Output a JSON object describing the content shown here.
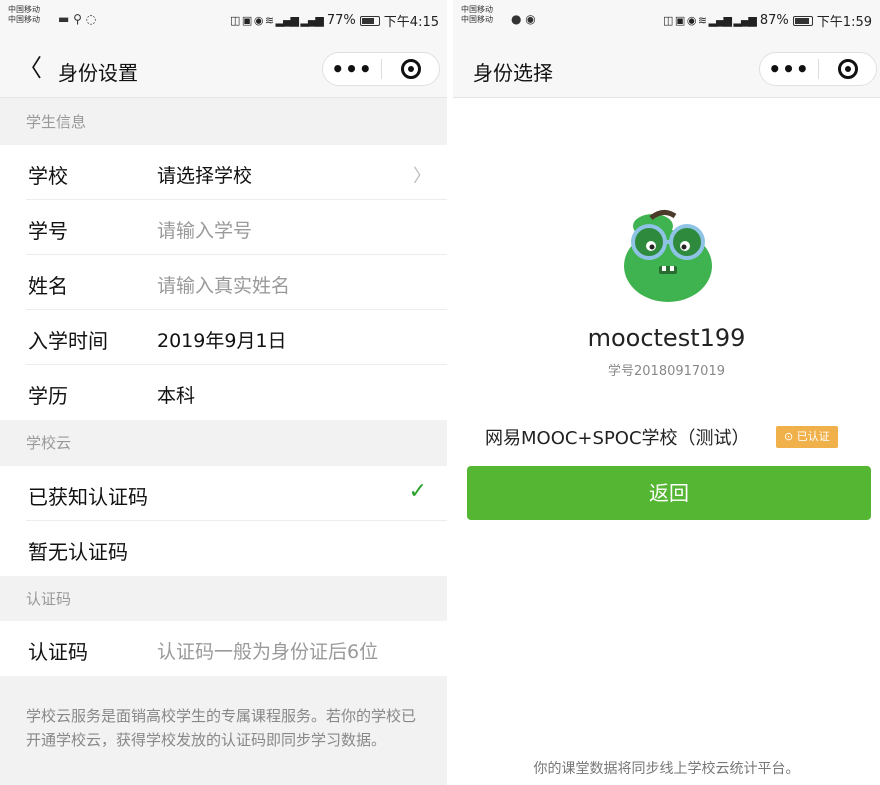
{
  "left": {
    "status": {
      "carrier_top": "中国移动",
      "carrier_bottom": "中国移动",
      "battery_pct": "77%",
      "time": "下午4:15",
      "battery_level": 0.77
    },
    "nav": {
      "back_icon": "chevron-left",
      "title": "身份设置",
      "more_icon": "•••",
      "close_icon": "target"
    },
    "sections": {
      "student_info": "学生信息",
      "school_cloud": "学校云",
      "auth_code": "认证码"
    },
    "rows": {
      "school": {
        "label": "学校",
        "value": "请选择学校"
      },
      "student_no": {
        "label": "学号",
        "placeholder": "请输入学号"
      },
      "name": {
        "label": "姓名",
        "placeholder": "请输入真实姓名"
      },
      "enroll": {
        "label": "入学时间",
        "value": "2019年9月1日"
      },
      "degree": {
        "label": "学历",
        "value": "本科"
      },
      "has_code": {
        "label": "已获知认证码",
        "check": "✓"
      },
      "no_code": {
        "label": "暂无认证码"
      },
      "code": {
        "label": "认证码",
        "placeholder": "认证码一般为身份证后6位"
      }
    },
    "footnote": "学校云服务是面销高校学生的专属课程服务。若你的学校已开通学校云，获得学校发放的认证码即同步学习数据。"
  },
  "right": {
    "status": {
      "carrier_top": "中国移动",
      "carrier_bottom": "中国移动",
      "battery_pct": "87%",
      "time": "下午1:59",
      "battery_level": 0.87
    },
    "nav": {
      "title": "身份选择",
      "more_icon": "•••",
      "close_icon": "target"
    },
    "profile": {
      "username": "mooctest199",
      "student_no": "学号20180917019",
      "school": "网易MOOC+SPOC学校（测试）",
      "badge": "已认证",
      "badge_icon": "shield-check"
    },
    "return_button": "返回",
    "footer": "你的课堂数据将同步线上学校云统计平台。"
  }
}
